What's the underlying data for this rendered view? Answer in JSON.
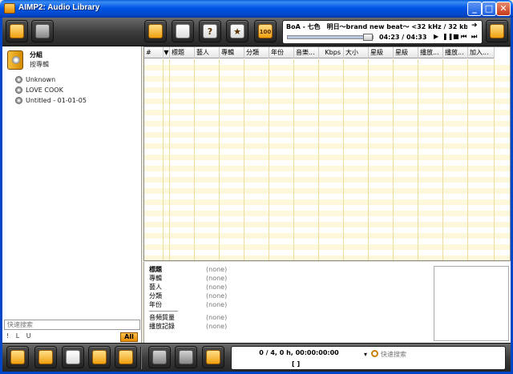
{
  "window": {
    "title": "AIMP2: Audio Library",
    "minimize_glyph": "_",
    "maximize_glyph": "□",
    "close_glyph": "✕"
  },
  "colors": {
    "titlebar_blue": "#0055e5",
    "toolbar_dark": "#3d3d3d",
    "accent_orange": "#f0a010",
    "row_stripe": "#fdf7dc"
  },
  "top_toolbar": {
    "buttons": [
      {
        "name": "add-folder-icon"
      },
      {
        "name": "edit-tags-icon"
      },
      {
        "name": "add-files-icon"
      },
      {
        "name": "new-playlist-icon"
      },
      {
        "name": "help-icon",
        "glyph": "?"
      },
      {
        "name": "favorite-icon",
        "glyph": "★"
      },
      {
        "name": "top-100-icon",
        "glyph": "100"
      },
      {
        "name": "settings-icon"
      }
    ]
  },
  "player": {
    "track": "BoA - 七色　明日～brand new beat～ <32 kHz / 32 kb...",
    "next_glyph": "➜",
    "time": "04:23 / 04:33",
    "progress": 0.96,
    "controls": [
      "▶",
      "❚❚",
      "■",
      "⏮",
      "⏭"
    ]
  },
  "library": {
    "group_title": "分組",
    "group_subtitle": "按專輯",
    "items": [
      "Unknown",
      "LOVE COOK",
      "Untitled - 01-01-05"
    ],
    "quick_search_placeholder": "快速搜索",
    "filter_letters": "! L U",
    "all_label": "All"
  },
  "playlist": {
    "columns": [
      "#",
      "▼",
      "標題",
      "藝人",
      "專輯",
      "分類",
      "年份",
      "音樂...",
      "Kbps",
      "大小",
      "星級",
      "星級",
      "播放...",
      "播放...",
      "加入..."
    ]
  },
  "info": {
    "fields": [
      {
        "label": "標題",
        "value": "(none)",
        "bold": true
      },
      {
        "label": "專輯",
        "value": "(none)"
      },
      {
        "label": "藝人",
        "value": "(none)"
      },
      {
        "label": "分類",
        "value": "(none)"
      },
      {
        "label": "年份",
        "value": "(none)"
      },
      {
        "label": "音頻質量",
        "value": "(none)"
      },
      {
        "label": "播放記錄",
        "value": "(none)"
      }
    ]
  },
  "bottom_toolbar": {
    "status": "0 / 4,  0 h,  00:00:00:00",
    "brackets": "[ ]",
    "dropdown_glyph": "▾",
    "quick_search_placeholder": "快速搜索"
  }
}
